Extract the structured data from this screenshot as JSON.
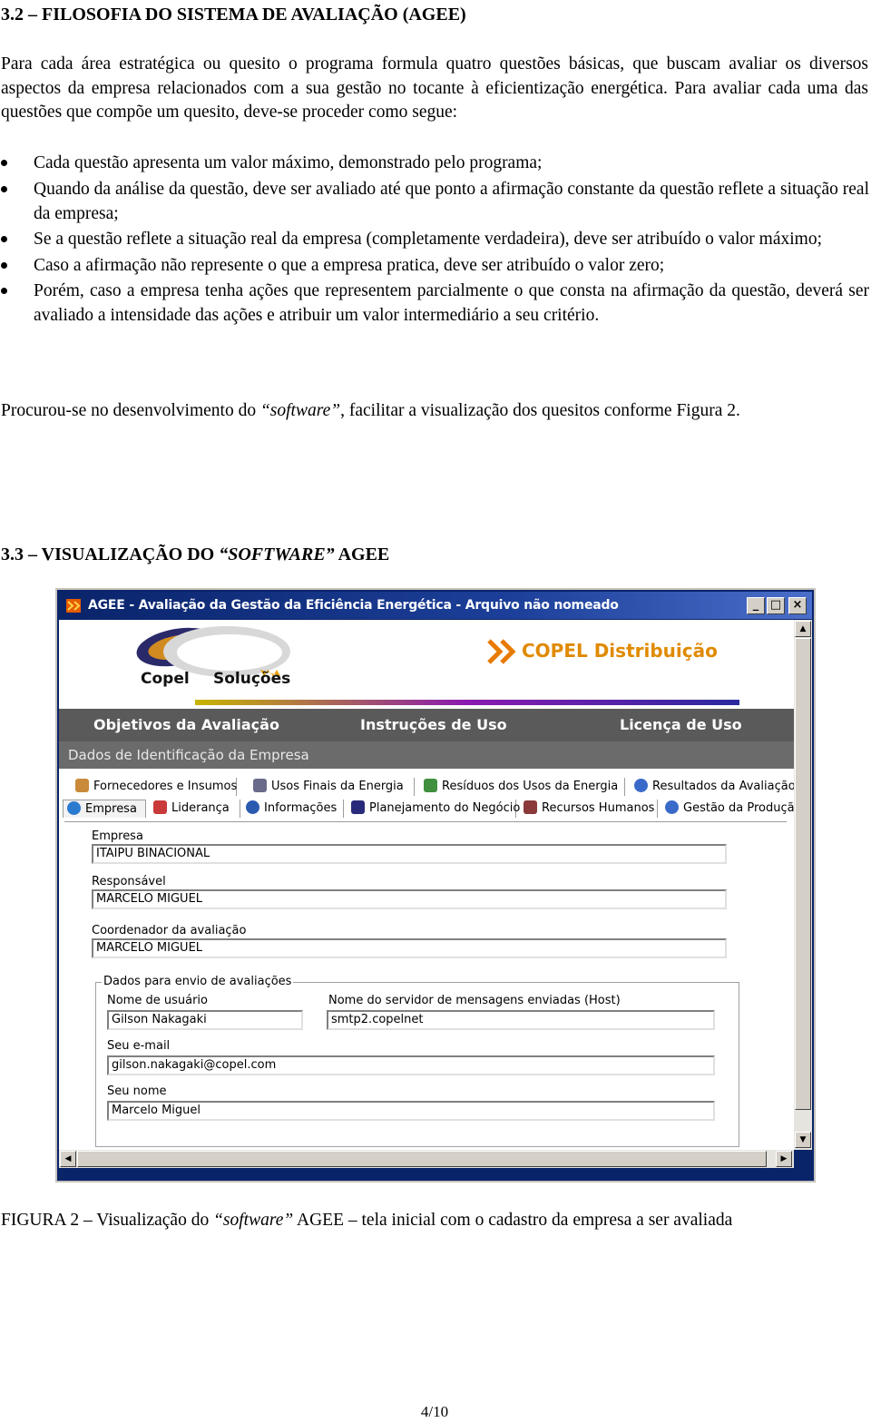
{
  "doc": {
    "section_32_title": "3.2 – FILOSOFIA DO SISTEMA DE AVALIAÇÃO (AGEE)",
    "intro": "Para cada área estratégica ou quesito o programa formula quatro questões básicas, que buscam avaliar os diversos aspectos da empresa relacionados com a sua gestão no tocante à eficientização energética. Para avaliar cada uma das questões que compõe um quesito, deve-se proceder como segue:",
    "bullets": [
      "Cada questão apresenta um valor máximo, demonstrado pelo programa;",
      "Quando da análise da questão, deve ser avaliado até que ponto a afirmação constante da questão reflete a situação real da empresa;",
      "Se a questão reflete a situação real da empresa (completamente verdadeira), deve ser atribuído o valor máximo;",
      "Caso a afirmação não represente o que a empresa pratica, deve ser atribuído o valor zero;",
      "Porém, caso a empresa tenha ações que representem parcialmente o que consta na afirmação da questão, deverá ser avaliado a intensidade das ações e atribuir um valor intermediário a seu critério."
    ],
    "software_para_before": "Procurou-se no desenvolvimento do ",
    "software_word": "“software”",
    "software_para_after": ", facilitar a visualização dos quesitos conforme Figura 2.",
    "section_33_prefix": "3.3 – VISUALIZAÇÃO DO ",
    "section_33_italic": "“SOFTWARE”",
    "section_33_suffix": " AGEE",
    "caption_before": "FIGURA 2 – Visualização do ",
    "caption_italic": "“software”",
    "caption_after": " AGEE – tela inicial com o cadastro da empresa a ser avaliada",
    "page_number": "4/10"
  },
  "window": {
    "title": "AGEE - Avaliação da Gestão da Eficiência Energética - Arquivo não nomeado",
    "btn_min": "_",
    "btn_max": "□",
    "btn_close": "×",
    "brand_left_1": "Copel",
    "brand_left_2": "Soluções",
    "brand_right": "COPEL Distribuição",
    "menu": [
      "Objetivos da Avaliação",
      "Instruções de Uso",
      "Licença de Uso"
    ],
    "id_bar": "Dados de Identificação da Empresa",
    "tabs_row1": [
      "Fornecedores e Insumos",
      "Usos Finais da Energia",
      "Resíduos dos Usos da Energia",
      "Resultados da Avaliação"
    ],
    "tabs_row2": [
      "Empresa",
      "Liderança",
      "Informações",
      "Planejamento do Negócio",
      "Recursos Humanos",
      "Gestão da Produção"
    ],
    "form": {
      "empresa_label": "Empresa",
      "empresa_value": "ITAIPU BINACIONAL",
      "responsavel_label": "Responsável",
      "responsavel_value": "MARCELO MIGUEL",
      "coordenador_label": "Coordenador da avaliação",
      "coordenador_value": "MARCELO MIGUEL",
      "group_label": "Dados para envio de avaliações",
      "usuario_label": "Nome de usuário",
      "usuario_value": "Gilson Nakagaki",
      "servidor_label": "Nome do servidor de mensagens enviadas (Host)",
      "servidor_value": "smtp2.copelnet",
      "email_label": "Seu e-mail",
      "email_value": "gilson.nakagaki@copel.com",
      "nome_label": "Seu nome",
      "nome_value": "Marcelo Miguel"
    }
  },
  "colors": {
    "title_bar": "#0a246a",
    "menu_bar": "#5a5a5a",
    "brand_orange": "#e08a00"
  }
}
